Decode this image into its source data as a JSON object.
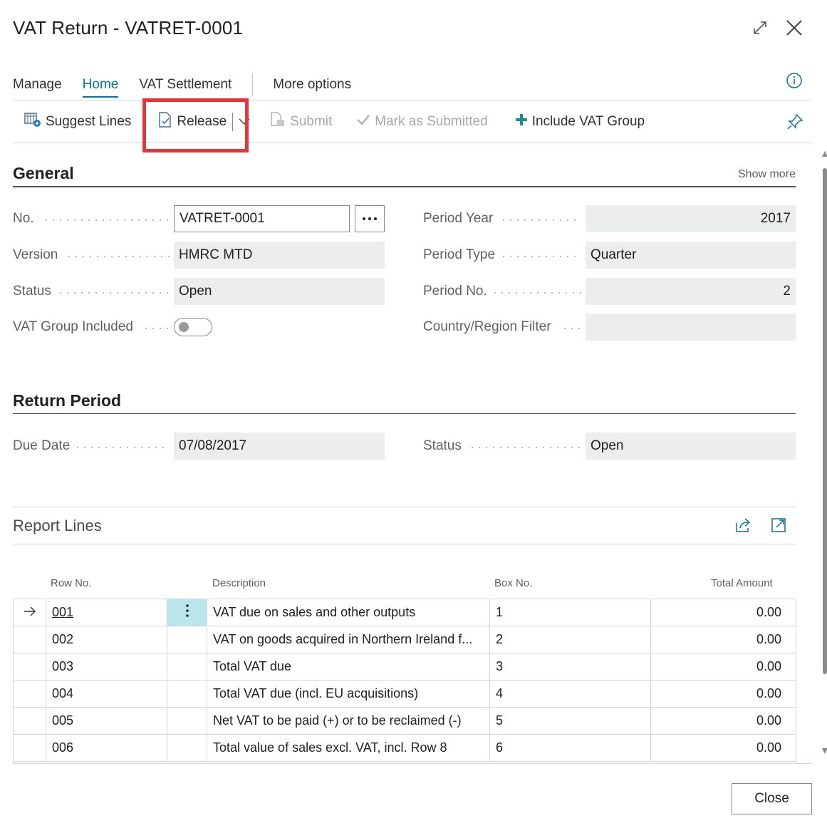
{
  "window": {
    "title": "VAT Return - VATRET-0001"
  },
  "menu": {
    "tabs": [
      "Manage",
      "Home",
      "VAT Settlement"
    ],
    "more": "More options"
  },
  "actions": {
    "suggest_lines": "Suggest Lines",
    "release": "Release",
    "submit": "Submit",
    "mark_submitted": "Mark as Submitted",
    "include_vat_group": "Include VAT Group"
  },
  "general": {
    "title": "General",
    "show_more": "Show more",
    "no_label": "No.",
    "no_value": "VATRET-0001",
    "version_label": "Version",
    "version_value": "HMRC MTD",
    "status_label": "Status",
    "status_value": "Open",
    "vat_group_label": "VAT Group Included",
    "vat_group_value": false,
    "period_year_label": "Period Year",
    "period_year_value": "2017",
    "period_type_label": "Period Type",
    "period_type_value": "Quarter",
    "period_no_label": "Period No.",
    "period_no_value": "2",
    "country_filter_label": "Country/Region Filter",
    "country_filter_value": ""
  },
  "return_period": {
    "title": "Return Period",
    "due_date_label": "Due Date",
    "due_date_value": "07/08/2017",
    "status_label": "Status",
    "status_value": "Open"
  },
  "report_lines": {
    "title": "Report Lines",
    "columns": {
      "row_no": "Row No.",
      "description": "Description",
      "box_no": "Box No.",
      "total_amount": "Total Amount"
    },
    "rows": [
      {
        "row_no": "001",
        "description": "VAT due on sales and other outputs",
        "box_no": "1",
        "amount": "0.00"
      },
      {
        "row_no": "002",
        "description": "VAT on goods acquired in Northern Ireland f...",
        "box_no": "2",
        "amount": "0.00"
      },
      {
        "row_no": "003",
        "description": "Total VAT due",
        "box_no": "3",
        "amount": "0.00"
      },
      {
        "row_no": "004",
        "description": "Total VAT due (incl. EU acquisitions)",
        "box_no": "4",
        "amount": "0.00"
      },
      {
        "row_no": "005",
        "description": "Net VAT to be paid (+) or to be reclaimed (-)",
        "box_no": "5",
        "amount": "0.00"
      },
      {
        "row_no": "006",
        "description": "Total value of sales excl. VAT, incl. Row 8",
        "box_no": "6",
        "amount": "0.00"
      }
    ]
  },
  "footer": {
    "close": "Close"
  },
  "colors": {
    "accent": "#0f7490",
    "highlight": "#e2363a",
    "selected_cell": "#b8e6ea",
    "field_bg": "#eceded"
  }
}
